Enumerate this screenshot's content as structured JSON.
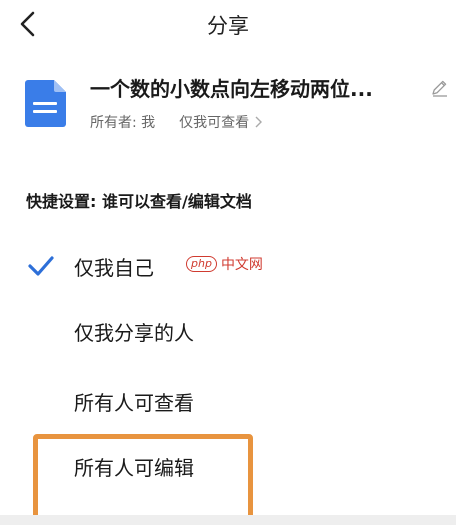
{
  "header": {
    "title": "分享"
  },
  "document": {
    "title": "一个数的小数点向左移动两位...",
    "owner_text": "所有者: 我",
    "permission_text": "仅我可查看",
    "icon": "doc-file-icon",
    "icon_color": "#3a7de8"
  },
  "quick_settings": {
    "heading": "快捷设置: 谁可以查看/编辑文档",
    "options": [
      {
        "label": "仅我自己",
        "selected": true
      },
      {
        "label": "仅我分享的人",
        "selected": false
      },
      {
        "label": "所有人可查看",
        "selected": false
      },
      {
        "label": "所有人可编辑",
        "selected": false,
        "highlighted": true
      }
    ]
  },
  "watermark": {
    "logo": "php",
    "text": "中文网"
  },
  "colors": {
    "check": "#2d6fd8",
    "highlight": "#e8943f",
    "watermark": "#d03b30"
  }
}
